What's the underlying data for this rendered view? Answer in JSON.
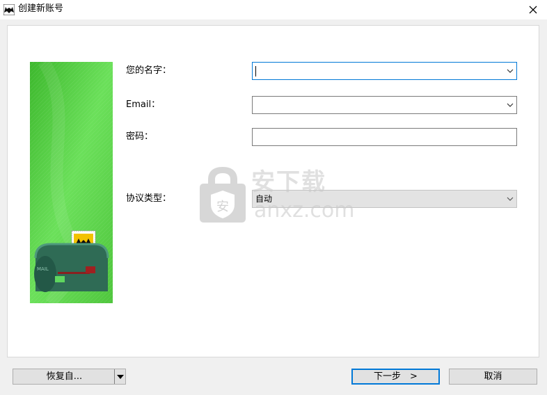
{
  "window": {
    "title": "创建新账号",
    "close_glyph": "✕"
  },
  "form": {
    "name_label": "您的名字：",
    "name_value": "",
    "email_label": "Email：",
    "email_value": "",
    "password_label": "密码：",
    "password_value": "",
    "protocol_label": "协议类型：",
    "protocol_value": "自动"
  },
  "watermark": {
    "text_cn": "安下载",
    "text_en": "anxz.com",
    "shield_glyph": "安"
  },
  "buttons": {
    "restore_label": "恢复自...",
    "next_label": "下一步　>",
    "cancel_label": "取消"
  },
  "icons": {
    "app": "bat-envelope-icon",
    "dropdown": "chevron-down-icon",
    "split": "triangle-down-icon",
    "banner": "mailbox-illustration"
  },
  "colors": {
    "banner_green": "#4dc13a",
    "focus_blue": "#0078d7",
    "mailbox_green": "#2f6b55"
  }
}
